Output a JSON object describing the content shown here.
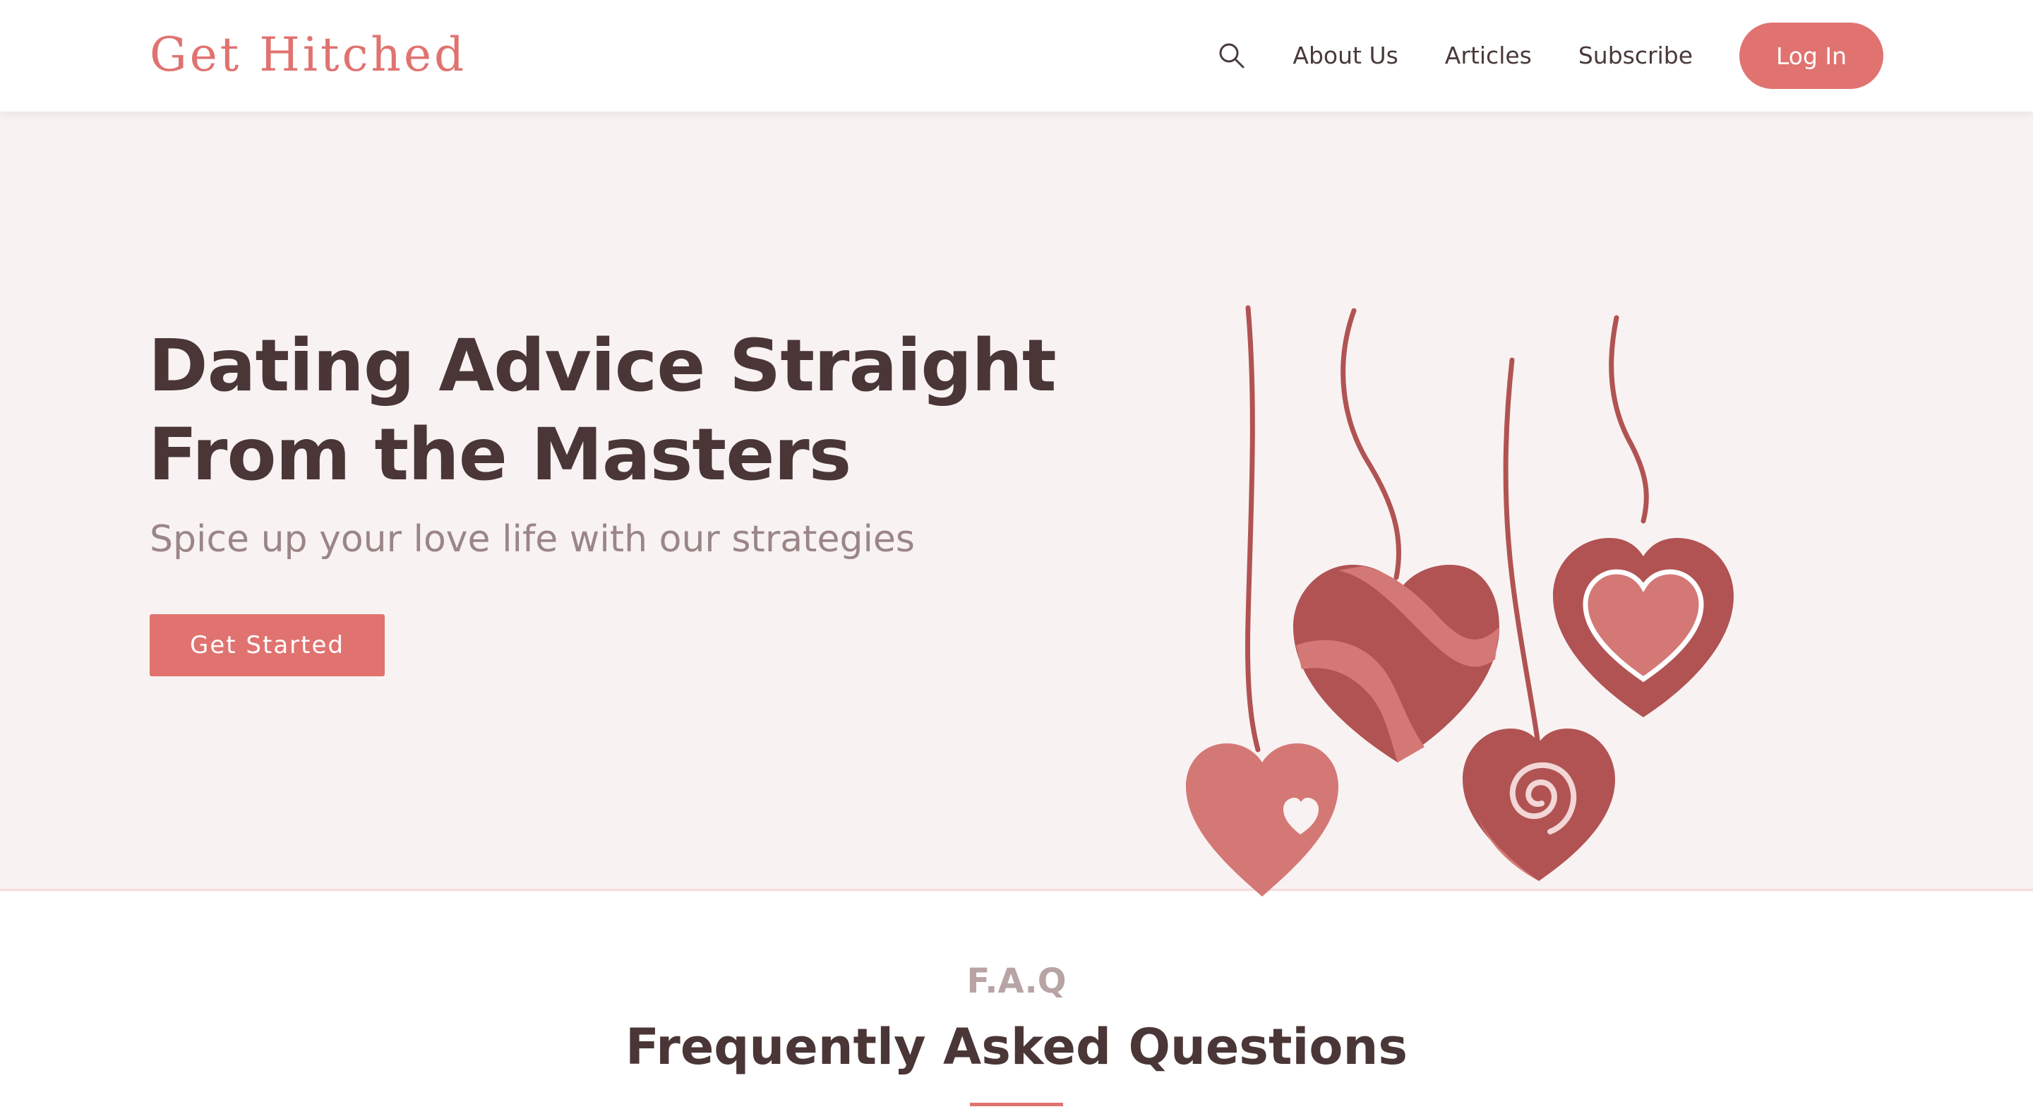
{
  "header": {
    "logo": "Get Hitched",
    "search_icon": "search-icon",
    "nav": [
      "About Us",
      "Articles",
      "Subscribe"
    ],
    "login_label": "Log In"
  },
  "hero": {
    "title_line1": "Dating Advice Straight",
    "title_line2": "From the Masters",
    "subtitle": "Spice up your love life with our strategies",
    "cta_label": "Get Started",
    "illustration": "hanging-hearts-illustration"
  },
  "faq": {
    "eyebrow": "F.A.Q",
    "title": "Frequently Asked Questions"
  },
  "colors": {
    "accent": "#e07370",
    "hero_bg": "#f9f2f2",
    "heading": "#4a3636",
    "subtitle": "#9a8686",
    "heart_dark": "#b15353",
    "heart_light": "#d47876"
  }
}
